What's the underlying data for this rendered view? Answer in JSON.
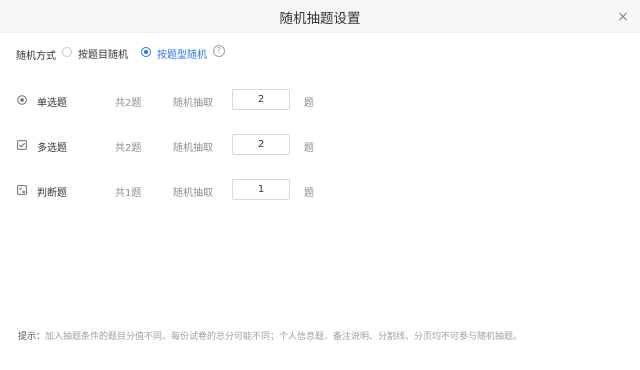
{
  "dialog": {
    "title": "随机抽题设置",
    "close_icon": "×"
  },
  "mode": {
    "label": "随机方式",
    "options": [
      {
        "label": "按题目随机",
        "checked": false
      },
      {
        "label": "按题型随机",
        "checked": true
      }
    ],
    "help_icon": "?"
  },
  "questions": [
    {
      "icon": "radio-icon",
      "name": "单选题",
      "total": "共2题",
      "draw_label": "随机抽取",
      "value": "2",
      "unit": "题"
    },
    {
      "icon": "checkbox-icon",
      "name": "多选题",
      "total": "共2题",
      "draw_label": "随机抽取",
      "value": "2",
      "unit": "题"
    },
    {
      "icon": "judge-icon",
      "name": "判断题",
      "total": "共1题",
      "draw_label": "随机抽取",
      "value": "1",
      "unit": "题"
    }
  ],
  "tip": {
    "key": "提示：",
    "text": "加入抽题条件的题目分值不同、每份试卷的总分可能不同；个人信息题、备注说明、分割线、分页均不可参与随机抽题。"
  },
  "colors": {
    "accent": "#2a74e5",
    "header_bg": "#f5f6f8"
  }
}
